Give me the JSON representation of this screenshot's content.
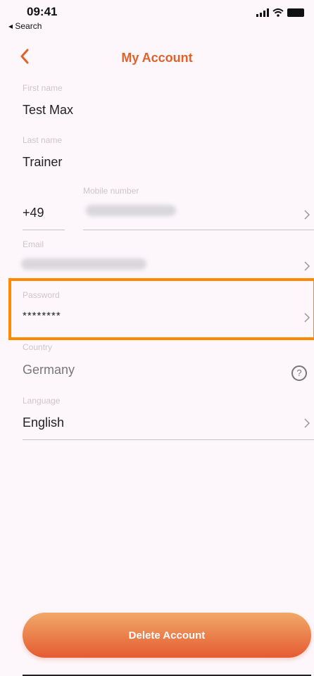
{
  "status_bar": {
    "time": "09:41",
    "back_app": "◂ Search"
  },
  "nav": {
    "title": "My Account"
  },
  "colors": {
    "accent": "#e0622a",
    "highlight": "#ff8a00",
    "button_top": "#f0a968",
    "button_bottom": "#e65a32"
  },
  "form": {
    "first_name": {
      "label": "First name",
      "value": "Test Max"
    },
    "last_name": {
      "label": "Last name",
      "value": "Trainer"
    },
    "mobile": {
      "label": "Mobile number",
      "country_code": "+49"
    },
    "email": {
      "label": "Email"
    },
    "password": {
      "label": "Password",
      "value": "********"
    },
    "country": {
      "label": "Country",
      "value": "Germany",
      "help_icon": "?"
    },
    "language": {
      "label": "Language",
      "value": "English"
    }
  },
  "actions": {
    "delete_label": "Delete Account"
  }
}
